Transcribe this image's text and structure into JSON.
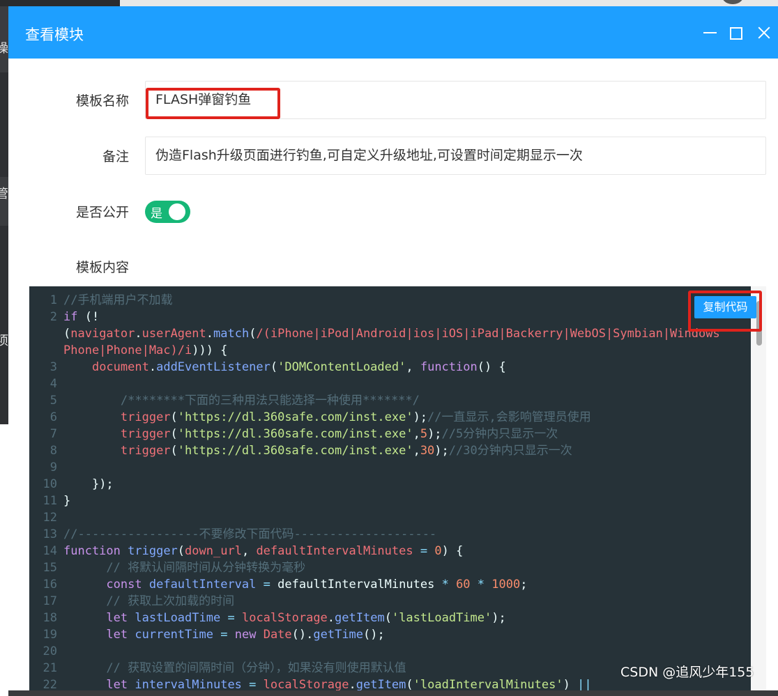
{
  "modal": {
    "title": "查看模块"
  },
  "form": {
    "name_label": "模板名称",
    "name_value": "FLASH弹窗钓鱼",
    "remark_label": "备注",
    "remark_value": "伪造Flash升级页面进行钓鱼,可自定义升级地址,可设置时间定期显示一次",
    "public_label": "是否公开",
    "public_switch_text": "是",
    "public_on": true,
    "content_label": "模板内容"
  },
  "editor": {
    "copy_button": "复制代码",
    "line_numbers": [
      "1",
      "2",
      "",
      "3",
      "4",
      "5",
      "6",
      "7",
      "8",
      "9",
      "10",
      "11",
      "12",
      "13",
      "14",
      "15",
      "16",
      "17",
      "18",
      "19",
      "20",
      "21",
      "22"
    ]
  },
  "background": {
    "side_glyphs": [
      "操",
      "管",
      "项"
    ]
  },
  "watermark": "CSDN @追风少年155",
  "colors": {
    "header": "#1e9fff",
    "switch_on": "#16b777",
    "highlight_box": "#e0231c",
    "editor_bg": "#263238"
  }
}
